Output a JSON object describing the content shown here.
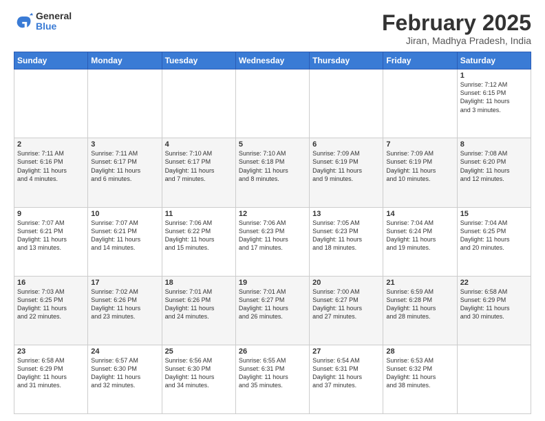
{
  "header": {
    "logo": {
      "general": "General",
      "blue": "Blue"
    },
    "title": "February 2025",
    "location": "Jiran, Madhya Pradesh, India"
  },
  "calendar": {
    "days_of_week": [
      "Sunday",
      "Monday",
      "Tuesday",
      "Wednesday",
      "Thursday",
      "Friday",
      "Saturday"
    ],
    "weeks": [
      [
        {
          "day": "",
          "info": ""
        },
        {
          "day": "",
          "info": ""
        },
        {
          "day": "",
          "info": ""
        },
        {
          "day": "",
          "info": ""
        },
        {
          "day": "",
          "info": ""
        },
        {
          "day": "",
          "info": ""
        },
        {
          "day": "1",
          "info": "Sunrise: 7:12 AM\nSunset: 6:15 PM\nDaylight: 11 hours\nand 3 minutes."
        }
      ],
      [
        {
          "day": "2",
          "info": "Sunrise: 7:11 AM\nSunset: 6:16 PM\nDaylight: 11 hours\nand 4 minutes."
        },
        {
          "day": "3",
          "info": "Sunrise: 7:11 AM\nSunset: 6:17 PM\nDaylight: 11 hours\nand 6 minutes."
        },
        {
          "day": "4",
          "info": "Sunrise: 7:10 AM\nSunset: 6:17 PM\nDaylight: 11 hours\nand 7 minutes."
        },
        {
          "day": "5",
          "info": "Sunrise: 7:10 AM\nSunset: 6:18 PM\nDaylight: 11 hours\nand 8 minutes."
        },
        {
          "day": "6",
          "info": "Sunrise: 7:09 AM\nSunset: 6:19 PM\nDaylight: 11 hours\nand 9 minutes."
        },
        {
          "day": "7",
          "info": "Sunrise: 7:09 AM\nSunset: 6:19 PM\nDaylight: 11 hours\nand 10 minutes."
        },
        {
          "day": "8",
          "info": "Sunrise: 7:08 AM\nSunset: 6:20 PM\nDaylight: 11 hours\nand 12 minutes."
        }
      ],
      [
        {
          "day": "9",
          "info": "Sunrise: 7:07 AM\nSunset: 6:21 PM\nDaylight: 11 hours\nand 13 minutes."
        },
        {
          "day": "10",
          "info": "Sunrise: 7:07 AM\nSunset: 6:21 PM\nDaylight: 11 hours\nand 14 minutes."
        },
        {
          "day": "11",
          "info": "Sunrise: 7:06 AM\nSunset: 6:22 PM\nDaylight: 11 hours\nand 15 minutes."
        },
        {
          "day": "12",
          "info": "Sunrise: 7:06 AM\nSunset: 6:23 PM\nDaylight: 11 hours\nand 17 minutes."
        },
        {
          "day": "13",
          "info": "Sunrise: 7:05 AM\nSunset: 6:23 PM\nDaylight: 11 hours\nand 18 minutes."
        },
        {
          "day": "14",
          "info": "Sunrise: 7:04 AM\nSunset: 6:24 PM\nDaylight: 11 hours\nand 19 minutes."
        },
        {
          "day": "15",
          "info": "Sunrise: 7:04 AM\nSunset: 6:25 PM\nDaylight: 11 hours\nand 20 minutes."
        }
      ],
      [
        {
          "day": "16",
          "info": "Sunrise: 7:03 AM\nSunset: 6:25 PM\nDaylight: 11 hours\nand 22 minutes."
        },
        {
          "day": "17",
          "info": "Sunrise: 7:02 AM\nSunset: 6:26 PM\nDaylight: 11 hours\nand 23 minutes."
        },
        {
          "day": "18",
          "info": "Sunrise: 7:01 AM\nSunset: 6:26 PM\nDaylight: 11 hours\nand 24 minutes."
        },
        {
          "day": "19",
          "info": "Sunrise: 7:01 AM\nSunset: 6:27 PM\nDaylight: 11 hours\nand 26 minutes."
        },
        {
          "day": "20",
          "info": "Sunrise: 7:00 AM\nSunset: 6:27 PM\nDaylight: 11 hours\nand 27 minutes."
        },
        {
          "day": "21",
          "info": "Sunrise: 6:59 AM\nSunset: 6:28 PM\nDaylight: 11 hours\nand 28 minutes."
        },
        {
          "day": "22",
          "info": "Sunrise: 6:58 AM\nSunset: 6:29 PM\nDaylight: 11 hours\nand 30 minutes."
        }
      ],
      [
        {
          "day": "23",
          "info": "Sunrise: 6:58 AM\nSunset: 6:29 PM\nDaylight: 11 hours\nand 31 minutes."
        },
        {
          "day": "24",
          "info": "Sunrise: 6:57 AM\nSunset: 6:30 PM\nDaylight: 11 hours\nand 32 minutes."
        },
        {
          "day": "25",
          "info": "Sunrise: 6:56 AM\nSunset: 6:30 PM\nDaylight: 11 hours\nand 34 minutes."
        },
        {
          "day": "26",
          "info": "Sunrise: 6:55 AM\nSunset: 6:31 PM\nDaylight: 11 hours\nand 35 minutes."
        },
        {
          "day": "27",
          "info": "Sunrise: 6:54 AM\nSunset: 6:31 PM\nDaylight: 11 hours\nand 37 minutes."
        },
        {
          "day": "28",
          "info": "Sunrise: 6:53 AM\nSunset: 6:32 PM\nDaylight: 11 hours\nand 38 minutes."
        },
        {
          "day": "",
          "info": ""
        }
      ]
    ]
  }
}
